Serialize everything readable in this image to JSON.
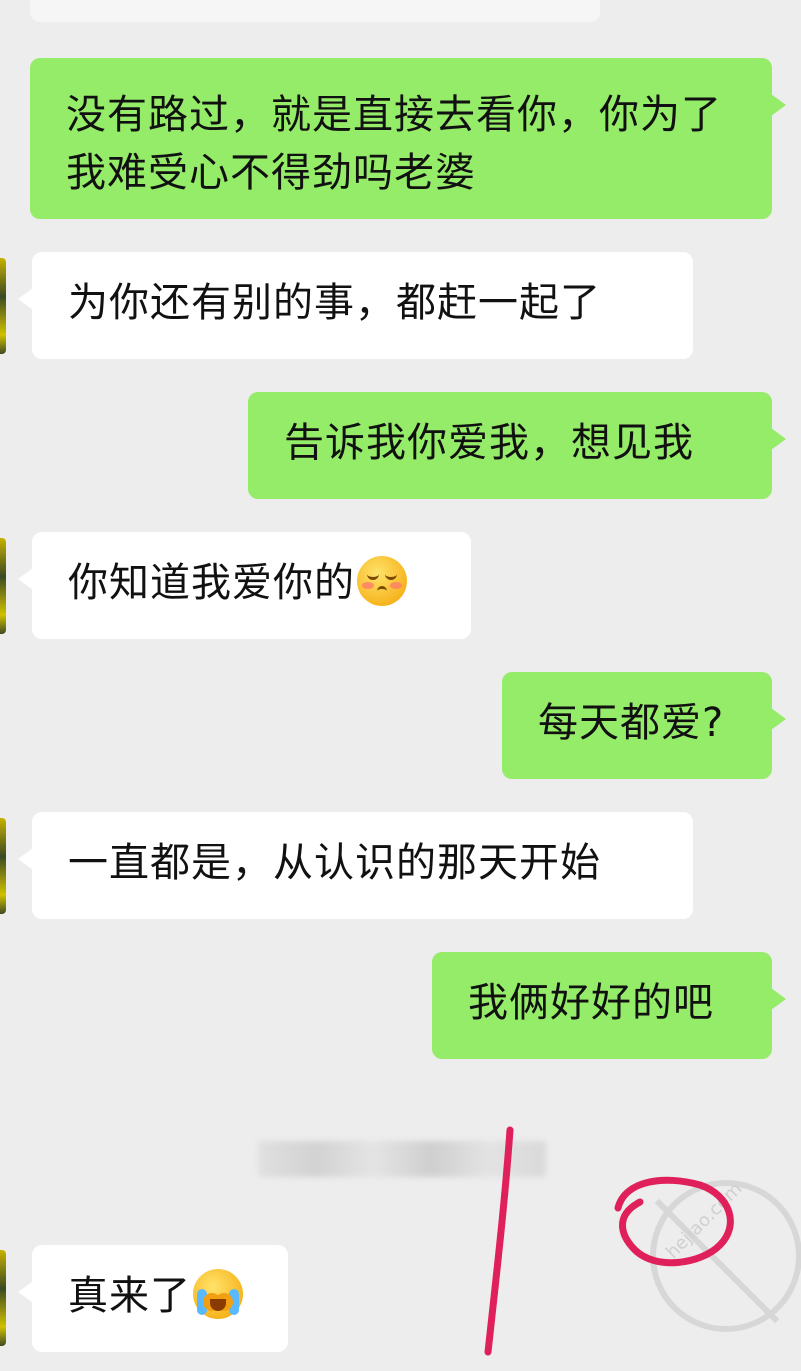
{
  "messages": [
    {
      "side": "out",
      "text": "没有路过，就是直接去看你，你为了我难受心不得劲吗老婆"
    },
    {
      "side": "in",
      "text": "为你还有别的事，都赶一起了"
    },
    {
      "side": "out",
      "text": "告诉我你爱我，想见我"
    },
    {
      "side": "in",
      "text": "你知道我爱你的",
      "emoji": "blushing-smile-emoji"
    },
    {
      "side": "out",
      "text": "每天都爱?"
    },
    {
      "side": "in",
      "text": "一直都是，从认识的那天开始"
    },
    {
      "side": "out",
      "text": "我俩好好的吧"
    },
    {
      "side": "in",
      "text": "真来了",
      "emoji": "crying-face-emoji"
    }
  ],
  "watermark": {
    "text": "hejiao.com"
  },
  "colors": {
    "background": "#ededed",
    "outgoing_bubble": "#95ec69",
    "incoming_bubble": "#ffffff",
    "annotation": "#e0205a"
  }
}
